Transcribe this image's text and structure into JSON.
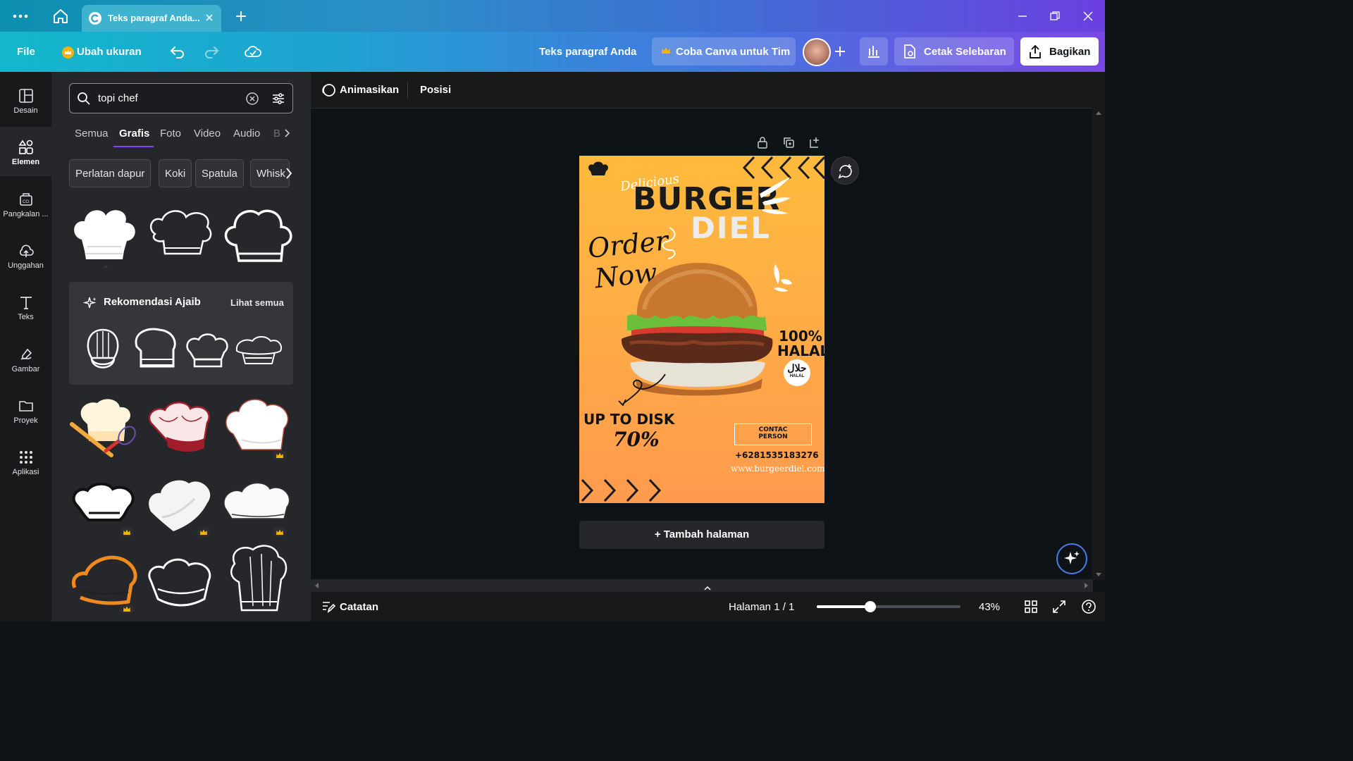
{
  "titlebar": {
    "tab_title": "Teks paragraf Anda...",
    "menu_icon": "more-horizontal-icon",
    "home_icon": "home-icon",
    "new_tab_icon": "plus-icon"
  },
  "toolbar": {
    "file": "File",
    "resize": "Ubah ukuran",
    "doc_title": "Teks paragraf Anda",
    "try_team": "Coba Canva untuk Tim",
    "print": "Cetak Selebaran",
    "share": "Bagikan"
  },
  "rail": {
    "items": [
      {
        "label": "Desain",
        "icon": "layout-icon"
      },
      {
        "label": "Elemen",
        "icon": "shapes-icon"
      },
      {
        "label": "Pangkalan ...",
        "icon": "brand-kit-icon"
      },
      {
        "label": "Unggahan",
        "icon": "cloud-upload-icon"
      },
      {
        "label": "Teks",
        "icon": "text-icon"
      },
      {
        "label": "Gambar",
        "icon": "draw-icon"
      },
      {
        "label": "Proyek",
        "icon": "folder-icon"
      },
      {
        "label": "Aplikasi",
        "icon": "apps-grid-icon"
      }
    ]
  },
  "panel": {
    "search_value": "topi chef",
    "categories": [
      "Semua",
      "Grafis",
      "Foto",
      "Video",
      "Audio",
      "B"
    ],
    "active_category": "Grafis",
    "chips": [
      "Perlatan dapur",
      "Koki",
      "Spatula",
      "Whisk"
    ],
    "reco_title": "Rekomendasi Ajaib",
    "reco_see_all": "Lihat semua"
  },
  "context_bar": {
    "animate": "Animasikan",
    "position": "Posisi"
  },
  "poster": {
    "script_top": "Delicious",
    "title1": "BURGER",
    "title2": "DIEL",
    "order1": "Order",
    "order2": "Now",
    "halal_pct": "100%",
    "halal": "HALAL",
    "halal_badge": "حلال",
    "halal_badge_sub": "HALAL",
    "promo": "UP TO DISK",
    "promo_pct": "70%",
    "contact": "CONTAC PERSON",
    "phone": "+6281535183276",
    "web": "www.burgeerdiel.com"
  },
  "add_page": "+ Tambah halaman",
  "bottom": {
    "notes": "Catatan",
    "page": "Halaman 1 / 1",
    "zoom": "43%",
    "zoom_fraction": 0.43
  },
  "colors": {
    "accent": "#8b3dff",
    "poster_top": "#ffbb3d",
    "poster_bottom": "#ff9a4e",
    "crown": "#f5b400"
  }
}
